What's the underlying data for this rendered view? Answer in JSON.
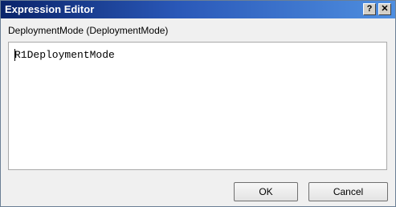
{
  "window": {
    "title": "Expression Editor",
    "help_label": "?",
    "close_label": "✕"
  },
  "field": {
    "label": "DeploymentMode (DeploymentMode)",
    "expression": "R1DeploymentMode"
  },
  "buttons": {
    "ok_label": "OK",
    "cancel_label": "Cancel"
  }
}
